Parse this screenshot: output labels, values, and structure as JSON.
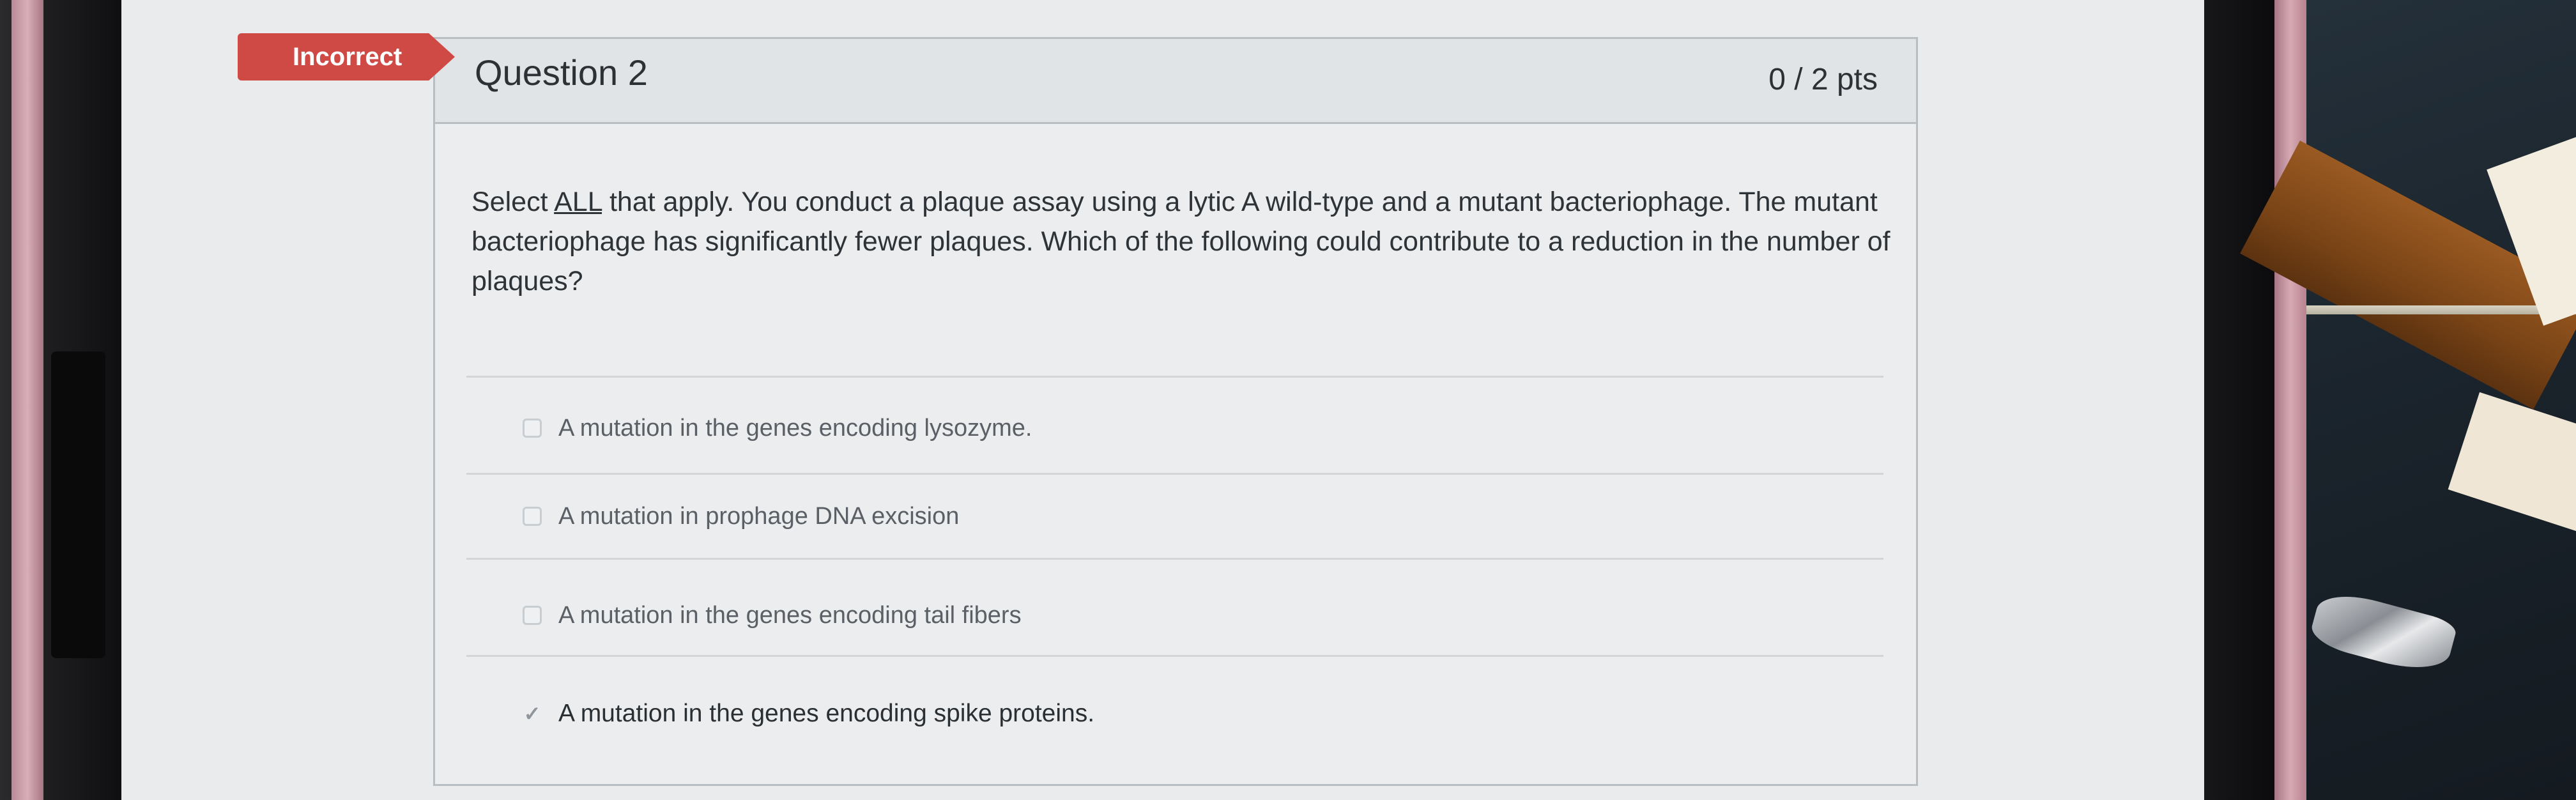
{
  "question": {
    "status_badge": "Incorrect",
    "title": "Question 2",
    "points": "0 / 2 pts",
    "prompt_prefix": "Select ",
    "prompt_emphasis": "ALL",
    "prompt_rest": " that apply. You conduct a plaque assay using a lytic A wild-type and a mutant bacteriophage. The mutant bacteriophage has significantly fewer plaques. Which of the following could contribute to a reduction in the number of plaques?",
    "answers": [
      {
        "label": "A mutation in the genes encoding lysozyme.",
        "checked": false
      },
      {
        "label": "A mutation in prophage DNA excision",
        "checked": false
      },
      {
        "label": "A mutation in the genes encoding tail fibers",
        "checked": false
      },
      {
        "label": "A mutation in the genes encoding spike proteins.",
        "checked": true
      }
    ]
  },
  "icons": {
    "check_glyph": "✓"
  },
  "colors": {
    "badge": "#cf4a45",
    "card_border": "#b9bec3",
    "header_bg": "#e1e4e6"
  }
}
